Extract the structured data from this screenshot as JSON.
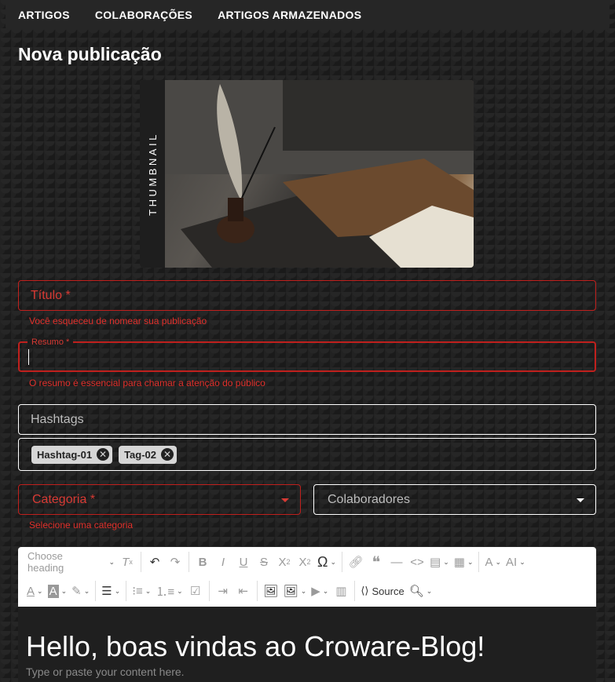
{
  "nav": {
    "items": [
      "ARTIGOS",
      "COLABORAÇÕES",
      "ARTIGOS ARMAZENADOS"
    ]
  },
  "page": {
    "title": "Nova publicação"
  },
  "thumbnail": {
    "label": "THUMBNAIL"
  },
  "form": {
    "title_label": "Título *",
    "title_error": "Você esqueceu de nomear sua publicação",
    "summary_label": "Resumo *",
    "summary_error": "O resumo é essencial para chamar a atenção do público",
    "hashtags_placeholder": "Hashtags",
    "tags": [
      "Hashtag-01",
      "Tag-02"
    ],
    "category_label": "Categoria *",
    "category_error": "Selecione uma categoria",
    "collaborators_label": "Colaboradores"
  },
  "editor": {
    "heading_select": "Choose heading",
    "source_label": "Source",
    "content_heading": "Hello, boas vindas ao Croware-Blog!",
    "placeholder": "Type or paste your content here."
  },
  "colors": {
    "error": "#c0201d",
    "background": "#1a1a1a",
    "nav": "#262626"
  }
}
